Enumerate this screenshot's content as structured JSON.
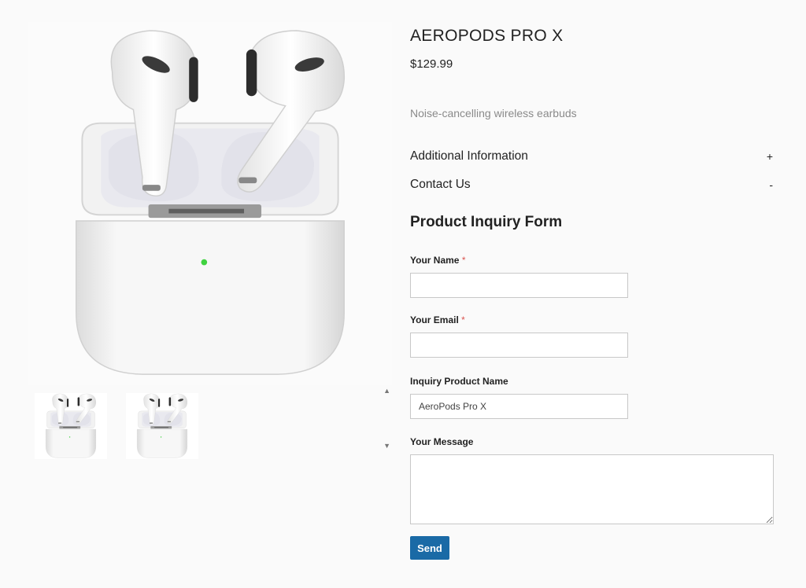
{
  "product": {
    "title": "AEROPODS PRO X",
    "price": "$129.99",
    "description": "Noise-cancelling wireless earbuds"
  },
  "gallery": {
    "up_arrow": "▲",
    "down_arrow": "▼"
  },
  "accordion": [
    {
      "label": "Additional Information",
      "sign": "+"
    },
    {
      "label": "Contact Us",
      "sign": "-"
    }
  ],
  "form": {
    "title": "Product Inquiry Form",
    "required_mark": "*",
    "name_label": "Your Name",
    "name_value": "",
    "email_label": "Your Email",
    "email_value": "",
    "product_label": "Inquiry Product Name",
    "product_value": "AeroPods Pro X",
    "message_label": "Your Message",
    "message_value": "",
    "send_label": "Send"
  },
  "colors": {
    "button": "#1a6aa6",
    "required": "#d9534f",
    "status_led": "#3fd23f"
  }
}
